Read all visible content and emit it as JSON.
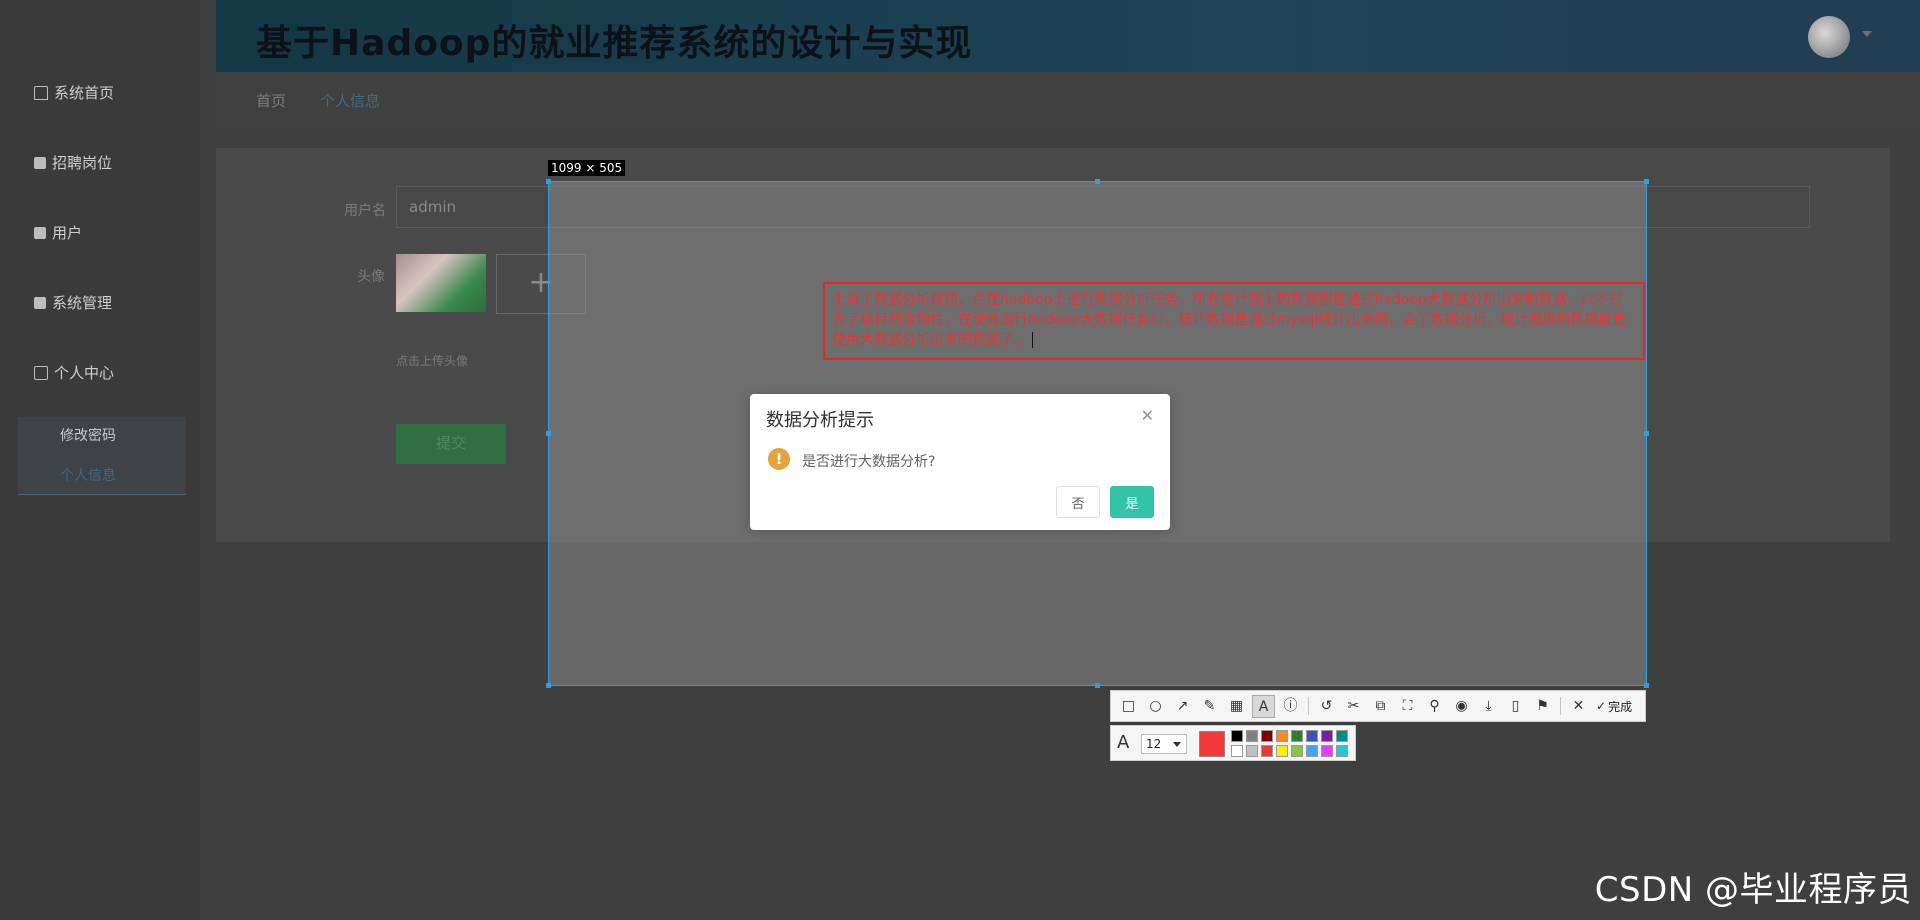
{
  "app": {
    "title": "基于Hadoop的就业推荐系统的设计与实现"
  },
  "sidebar": {
    "items": [
      {
        "label": "系统首页",
        "icon": "home-icon"
      },
      {
        "label": "招聘岗位",
        "icon": "briefcase-icon"
      },
      {
        "label": "用户",
        "icon": "chat-icon"
      },
      {
        "label": "系统管理",
        "icon": "toolbox-icon"
      },
      {
        "label": "个人中心",
        "icon": "calendar-icon"
      }
    ],
    "submenu": [
      {
        "label": "修改密码"
      },
      {
        "label": "个人信息"
      }
    ]
  },
  "breadcrumb": {
    "items": [
      "首页",
      "个人信息"
    ]
  },
  "form": {
    "username_label": "用户名",
    "username_value": "admin",
    "avatar_label": "头像",
    "upload_tip": "点击上传头像",
    "submit_label": "提交"
  },
  "capture": {
    "size_label": "1099 × 505",
    "annotation_text": "上点了数据分析按钮，会在hadoop上进行数据分析任务，所有统计图上的数据都是通过hadoop大数据分析出来的数据，只不过为了项目的流畅性，在没有运行hadoop大数据任务时，统计数据是通过mysql统计出来的，点了数据分析，统计图里的数据就是使用大数据分析出来的数据了。",
    "done_label": "完成",
    "font_size": "12",
    "current_color": "#f23a3a",
    "palette": [
      "#000000",
      "#808080",
      "#800000",
      "#f28c28",
      "#2e7d32",
      "#3f51b5",
      "#7b1fa2",
      "#008b8b",
      "#ffffff",
      "#c0c0c0",
      "#e53935",
      "#ffee00",
      "#8bc34a",
      "#42a5f5",
      "#e040fb",
      "#26c6da"
    ]
  },
  "dialog": {
    "title": "数据分析提示",
    "message": "是否进行大数据分析?",
    "cancel_label": "否",
    "confirm_label": "是"
  },
  "watermark": "CSDN @毕业程序员"
}
